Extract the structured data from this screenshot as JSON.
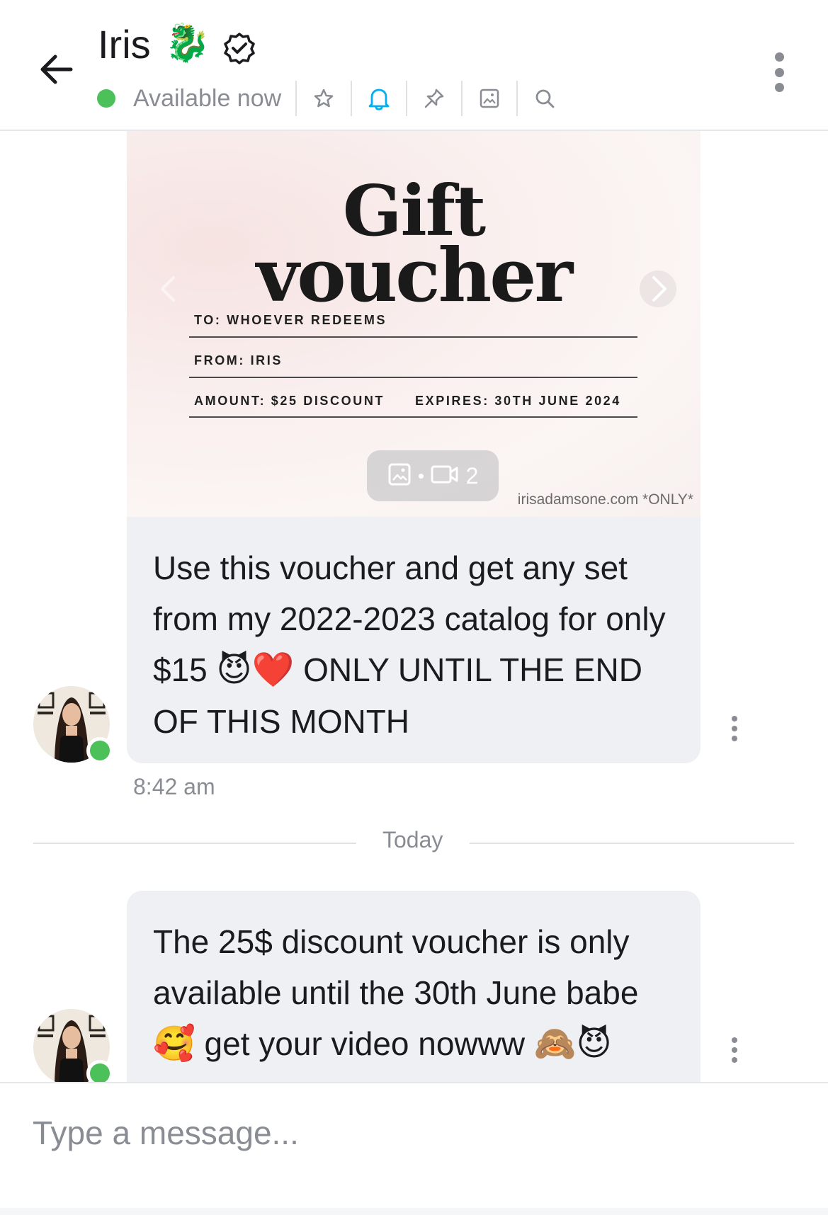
{
  "header": {
    "name": "Iris",
    "name_emoji": "🐉",
    "status": "Available now",
    "icons": [
      "back-arrow-icon",
      "verified-badge-icon",
      "star-icon",
      "bell-icon",
      "pin-icon",
      "image-icon",
      "search-icon",
      "more-vertical-icon"
    ],
    "status_color": "#4cc15a",
    "bell_color": "#00aff0"
  },
  "media_post": {
    "title_line1": "Gift",
    "title_line2": "voucher",
    "field_to": "TO: WHOEVER REDEEMS",
    "field_from": "FROM: IRIS",
    "field_amount": "AMOUNT: $25 DISCOUNT",
    "field_expires": "EXPIRES: 30TH JUNE 2024",
    "media_count": "2",
    "watermark": "irisadamsone.com *ONLY*"
  },
  "messages": [
    {
      "text_parts": [
        "Use this voucher and get any set from my 2022-2023 catalog for only $15 ",
        "😈❤️",
        " ONLY UNTIL THE END OF THIS MONTH"
      ],
      "time": "8:42 am"
    },
    {
      "text_parts": [
        "The 25$ discount voucher is only available until the 30th June babe ",
        "🥰",
        " get your video nowww ",
        "🙈😈"
      ]
    }
  ],
  "divider": {
    "label": "Today"
  },
  "composer": {
    "placeholder": "Type a message..."
  }
}
